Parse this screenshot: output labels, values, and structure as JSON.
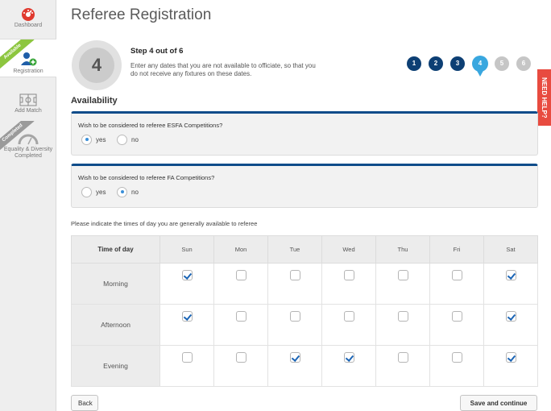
{
  "sidebar": {
    "items": [
      {
        "label": "Dashboard"
      },
      {
        "label": "Registration",
        "ribbon": "Available"
      },
      {
        "label": "Add Match"
      },
      {
        "label": "Equality & Diversity Completed",
        "ribbon": "Completed"
      }
    ]
  },
  "header": {
    "title": "Referee Registration",
    "step_number": "4",
    "step_title": "Step 4 out of 6",
    "step_description": "Enter any dates that you are not available to officiate, so that you do not receive any fixtures on these dates."
  },
  "progress": {
    "steps": [
      "1",
      "2",
      "3",
      "4",
      "5",
      "6"
    ],
    "current": 4
  },
  "need_help": "NEED HELP?",
  "availability": {
    "title": "Availability",
    "questions": [
      {
        "text": "Wish to be considered to referee ESFA Competitions?",
        "options": [
          "yes",
          "no"
        ],
        "selected": "yes"
      },
      {
        "text": "Wish to be considered to referee FA Competitions?",
        "options": [
          "yes",
          "no"
        ],
        "selected": "no"
      }
    ]
  },
  "times": {
    "label": "Please indicate the times of day you are generally available to referee",
    "header": "Time of day",
    "days": [
      "Sun",
      "Mon",
      "Tue",
      "Wed",
      "Thu",
      "Fri",
      "Sat"
    ],
    "rows": [
      {
        "name": "Morning",
        "checked": [
          true,
          false,
          false,
          false,
          false,
          false,
          true
        ]
      },
      {
        "name": "Afternoon",
        "checked": [
          true,
          false,
          false,
          false,
          false,
          false,
          true
        ]
      },
      {
        "name": "Evening",
        "checked": [
          false,
          false,
          true,
          true,
          false,
          false,
          true
        ]
      }
    ]
  },
  "buttons": {
    "back": "Back",
    "save": "Save and continue"
  },
  "colors": {
    "step_done": "#0d3f74",
    "step_current": "#39a7df",
    "step_todo": "#c6c6c6",
    "panel_accent": "#0f4c8a",
    "need_help": "#e84b40",
    "ribbon_available": "#8dc63f"
  },
  "icons": {
    "dashboard": "speedometer-icon",
    "registration": "add-user-icon",
    "add_match": "pitch-icon",
    "equality": "gauge-icon"
  }
}
